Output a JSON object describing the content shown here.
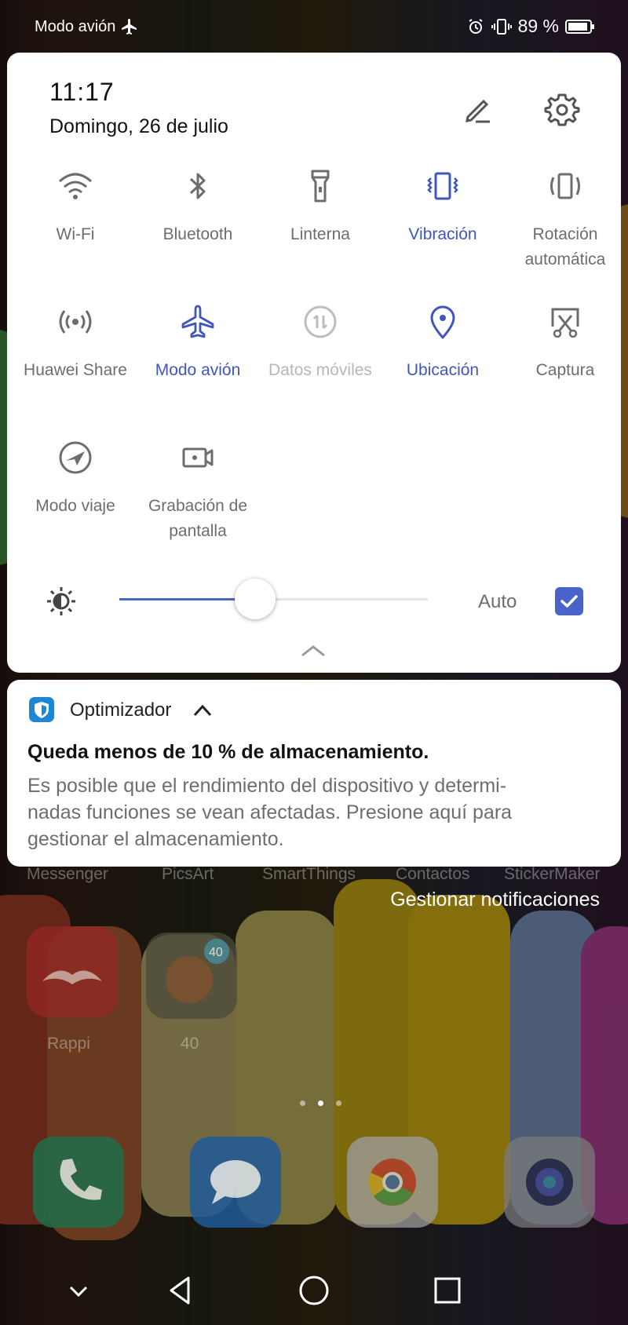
{
  "status_bar": {
    "mode_label": "Modo avión",
    "battery_text": "89 %"
  },
  "quick_settings": {
    "time": "11:17",
    "date": "Domingo, 26 de julio",
    "tiles": [
      {
        "label_1": "Wi-Fi",
        "label_2": "",
        "state": "off",
        "icon": "wifi-icon"
      },
      {
        "label_1": "Bluetooth",
        "label_2": "",
        "state": "off",
        "icon": "bluetooth-icon"
      },
      {
        "label_1": "Linterna",
        "label_2": "",
        "state": "off",
        "icon": "flashlight-icon"
      },
      {
        "label_1": "Vibración",
        "label_2": "",
        "state": "on",
        "icon": "vibration-icon"
      },
      {
        "label_1": "Rotación",
        "label_2": "automática",
        "state": "off",
        "icon": "auto-rotate-icon"
      },
      {
        "label_1": "Huawei Share",
        "label_2": "",
        "state": "off",
        "icon": "huawei-share-icon"
      },
      {
        "label_1": "Modo avión",
        "label_2": "",
        "state": "on",
        "icon": "airplane-icon"
      },
      {
        "label_1": "Datos móviles",
        "label_2": "",
        "state": "disabled",
        "icon": "mobile-data-icon"
      },
      {
        "label_1": "Ubicación",
        "label_2": "",
        "state": "on",
        "icon": "location-icon"
      },
      {
        "label_1": "Captura",
        "label_2": "",
        "state": "off",
        "icon": "screenshot-icon"
      },
      {
        "label_1": "Modo viaje",
        "label_2": "",
        "state": "off",
        "icon": "travel-mode-icon"
      },
      {
        "label_1": "Grabación de",
        "label_2": "pantalla",
        "state": "off",
        "icon": "screen-record-icon"
      }
    ],
    "brightness": {
      "level": 0.44,
      "auto_label": "Auto",
      "auto_checked": true
    },
    "accent_color": "#3f56c0"
  },
  "notification": {
    "app_name": "Optimizador",
    "title": "Queda menos de 10 % de almacenamiento.",
    "body_lines": [
      "Es posible que el rendimiento del dispositivo y determi-",
      "nadas funciones se vean afectadas. Presione aquí para",
      "gestionar el almacenamiento."
    ]
  },
  "manage_notifications": "Gestionar notificaciones",
  "home": {
    "faded_labels": [
      "Messenger",
      "PicsArt",
      "SmartThings",
      "Contactos",
      "StickerMaker"
    ],
    "apps": [
      {
        "label": "Rappi",
        "icon": "rappi-icon"
      },
      {
        "label": "40",
        "icon": "game-40-icon"
      }
    ],
    "dock": [
      "phone-icon",
      "messages-icon",
      "chrome-icon",
      "camera-icon"
    ]
  }
}
